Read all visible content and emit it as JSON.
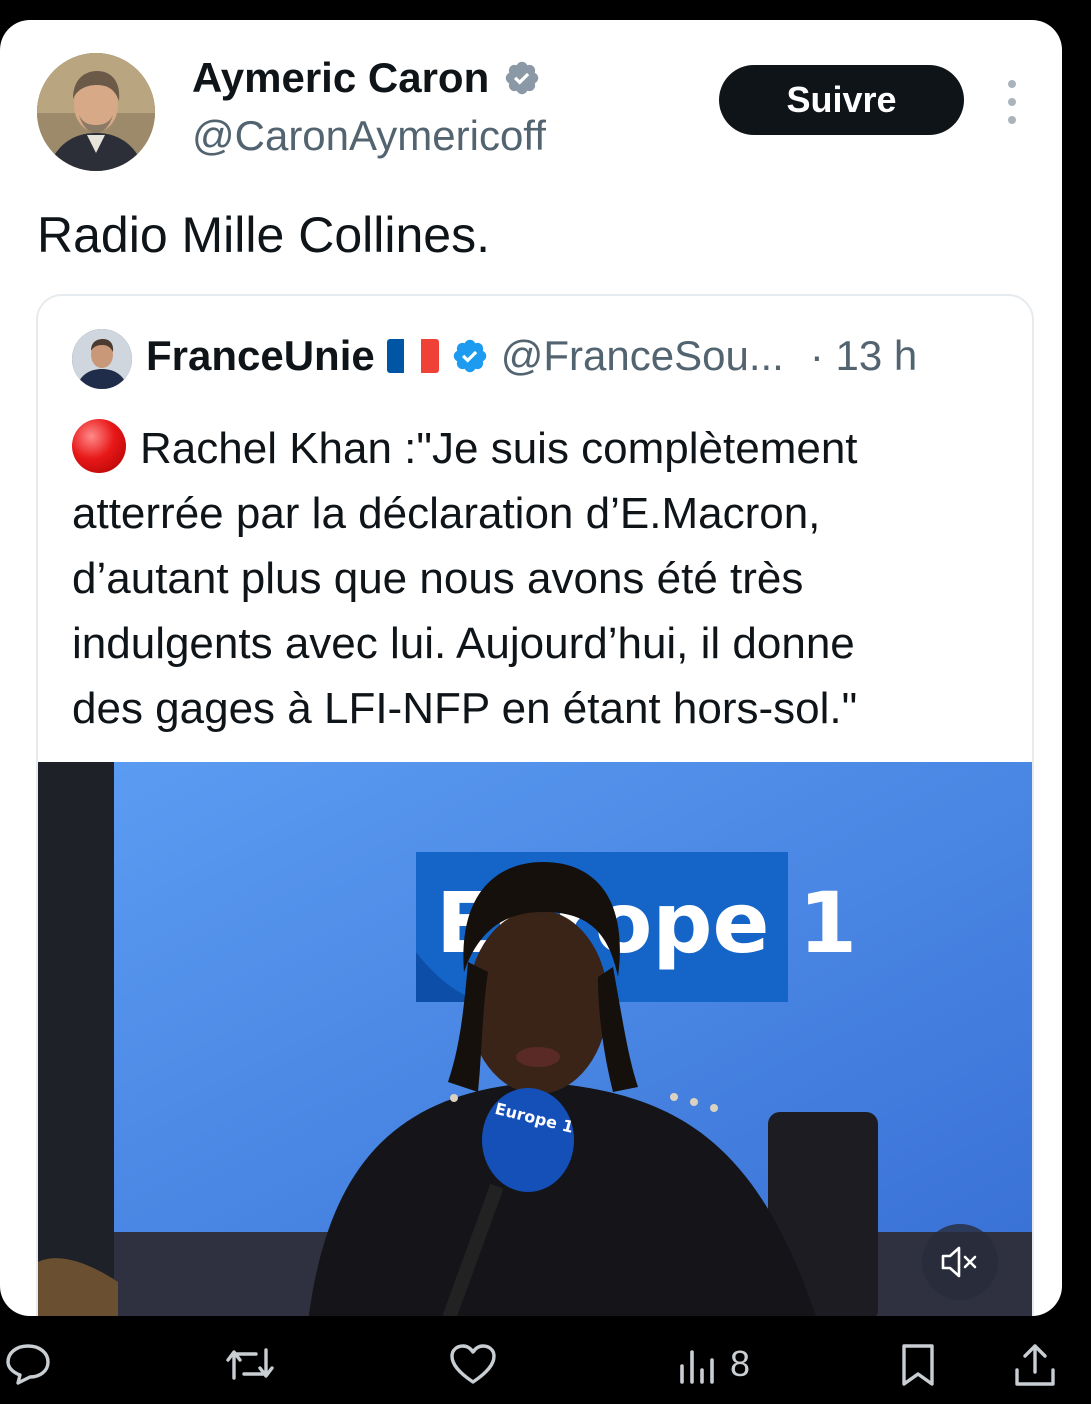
{
  "tweet": {
    "author_name": "Aymeric Caron",
    "author_handle": "@CaronAymericoff",
    "follow_label": "Suivre",
    "text": "Radio Mille Collines."
  },
  "quoted": {
    "name": "FranceUnie",
    "handle": "@FranceSou...",
    "time": "· 13 h",
    "lines": [
      "Rachel Khan :\"Je suis complètement",
      "atterrée par la déclaration d’E.Macron,",
      "d’autant plus que nous avons été très",
      "indulgents avec lui. Aujourd’hui, il donne",
      "des gages à LFI-NFP en étant hors-sol.\""
    ],
    "media_logo_text": "Europe 1",
    "mic_logo_text": "Europe 1"
  },
  "actions": {
    "views_count": "8"
  },
  "colors": {
    "verified": "#1d9bf0",
    "follow_bg": "#0f1419",
    "flag": [
      "#0055a4",
      "#ffffff",
      "#ef4135"
    ],
    "studio_blue": "#4a8bea"
  },
  "icons": [
    "verified-badge-icon",
    "more-options-icon",
    "red-circle-emoji",
    "france-flag-icon",
    "mute-icon",
    "reply-icon",
    "repost-icon",
    "like-icon",
    "views-icon",
    "bookmark-icon",
    "share-icon"
  ]
}
